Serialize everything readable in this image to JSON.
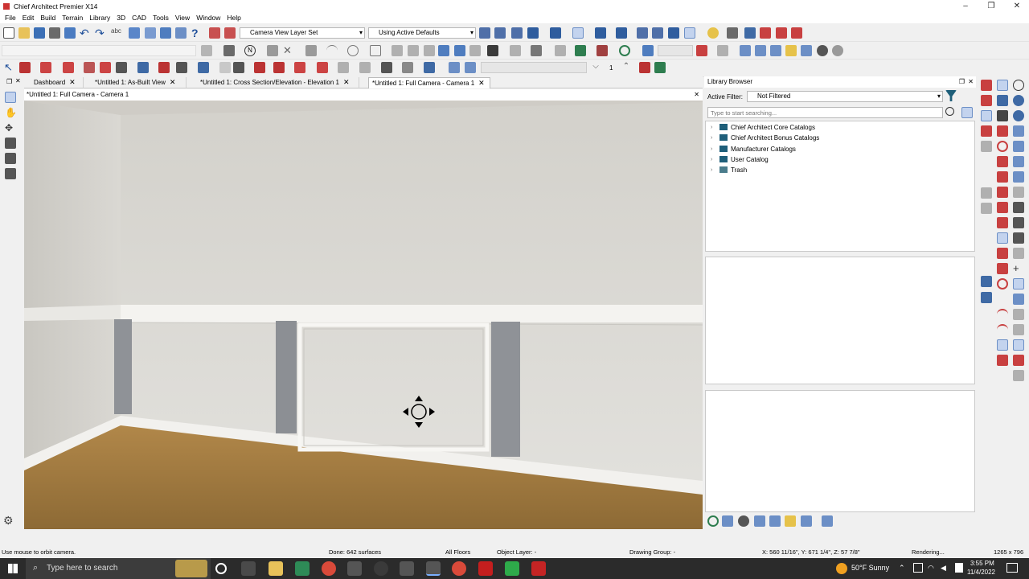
{
  "window": {
    "title": "Chief Architect Premier X14"
  },
  "menu": [
    "File",
    "Edit",
    "Build",
    "Terrain",
    "Library",
    "3D",
    "CAD",
    "Tools",
    "View",
    "Window",
    "Help"
  ],
  "toolbar": {
    "layer_set": "Camera View Layer Set",
    "defaults": "Using Active Defaults",
    "floor_number": "1"
  },
  "tabs": [
    {
      "label": "Dashboard"
    },
    {
      "label": "*Untitled 1: As-Built View"
    },
    {
      "label": "*Untitled 1: Cross Section/Elevation - Elevation 1"
    },
    {
      "label": "*Untitled 1: Full Camera - Camera 1"
    }
  ],
  "view": {
    "title": "*Untitled 1: Full Camera - Camera 1"
  },
  "library": {
    "title": "Library Browser",
    "filter_label": "Active Filter:",
    "filter_value": "Not Filtered",
    "search_placeholder": "Type to start searching...",
    "items": [
      "Chief Architect Core Catalogs",
      "Chief Architect Bonus Catalogs",
      "Manufacturer Catalogs",
      "User Catalog",
      "Trash"
    ]
  },
  "status": {
    "hint": "Use mouse to orbit camera.",
    "done": "Done:  642 surfaces",
    "floors": "All Floors",
    "object_layer": "Object Layer: -",
    "drawing_group": "Drawing Group: -",
    "coords": "X: 560 11/16\", Y: 671 1/4\", Z: 57 7/8\"",
    "rendering": "Rendering...",
    "size": "1265 x 796"
  },
  "taskbar": {
    "search_placeholder": "Type here to search",
    "weather": "50°F  Sunny",
    "time": "3:55 PM",
    "date": "11/4/2022"
  },
  "colors": {
    "accent": "#1e6fd0",
    "wall": "#dcdad5",
    "floor": "#a77a3e",
    "pilaster": "#8f9297"
  }
}
